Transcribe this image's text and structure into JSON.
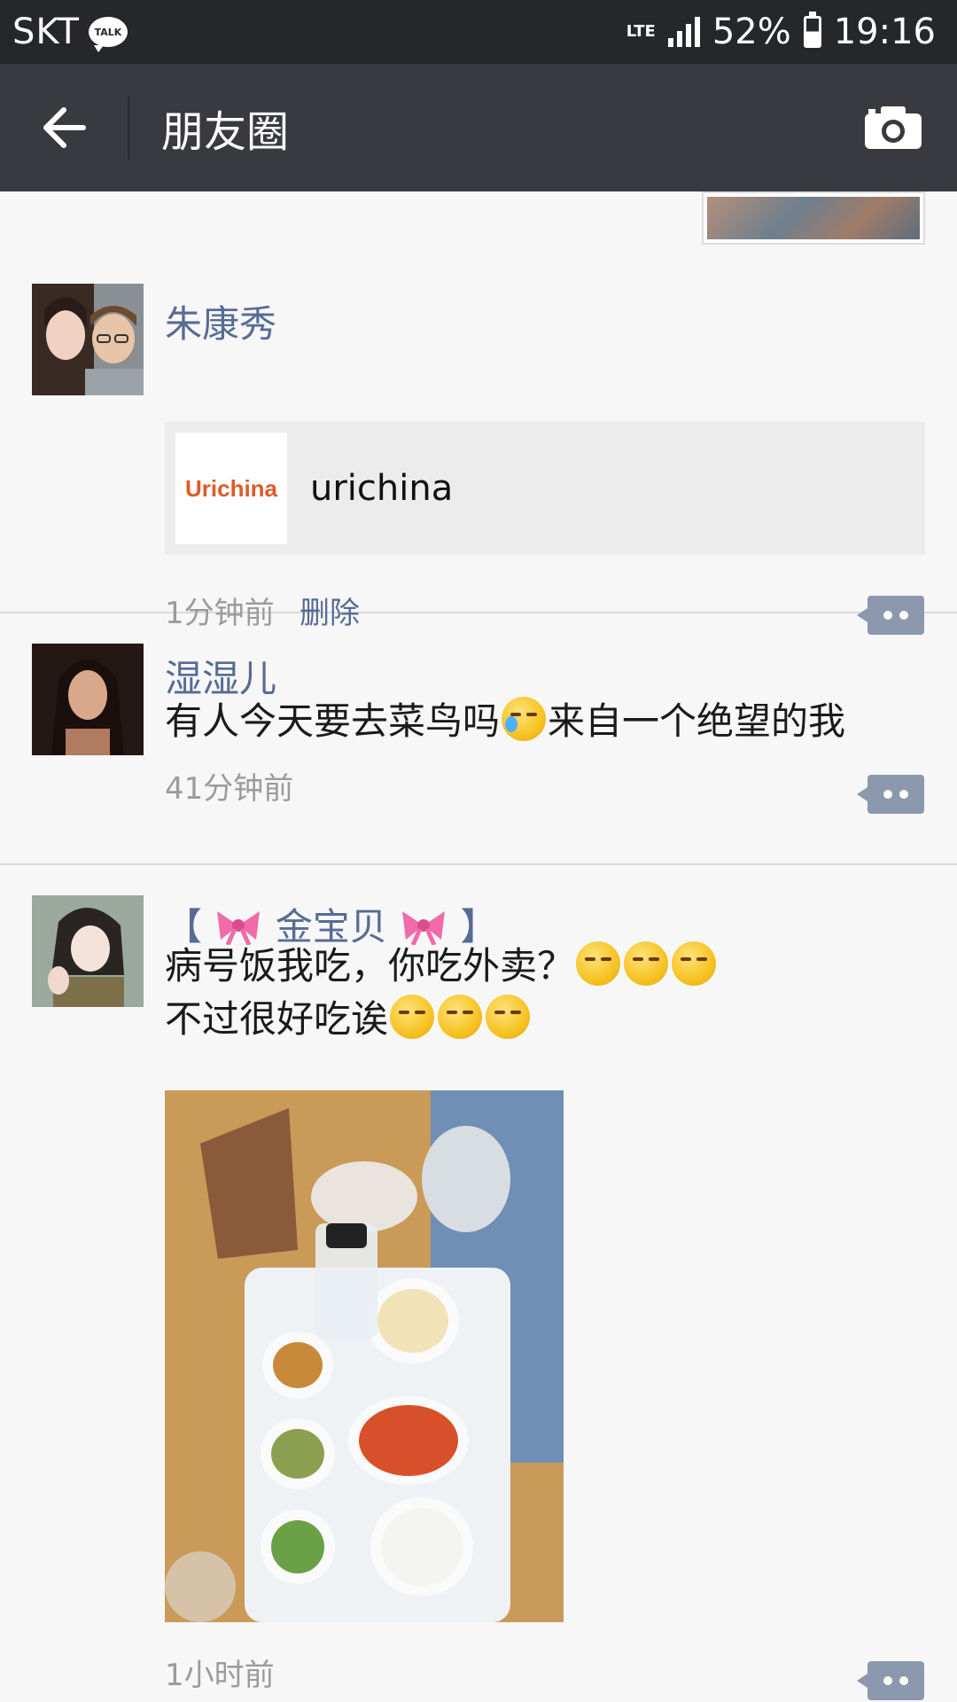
{
  "status_bar": {
    "carrier": "SKT",
    "talk_badge": "TALK",
    "network": "LTE",
    "battery": "52%",
    "battery_level": 0.52,
    "time": "19:16"
  },
  "title_bar": {
    "title": "朋友圈",
    "back_icon": "arrow-left-icon",
    "camera_icon": "camera-icon"
  },
  "posts": [
    {
      "username": "朱康秀",
      "link": {
        "thumb_text": "Urichina",
        "title": "urichina"
      },
      "time": "1分钟前",
      "delete_label": "删除"
    },
    {
      "username": "湿湿儿",
      "text_before": "有人今天要去菜鸟吗",
      "emoji": "crying-laughing-emoji",
      "text_after": "来自一个绝望的我",
      "time": "41分钟前"
    },
    {
      "username_prefix": "【",
      "username_bow": "ribbon-bow-emoji",
      "username": "金宝贝",
      "username_suffix": "】",
      "line1": "病号饭我吃，你吃外卖？",
      "line1_emoji": "smirk-sweat-emoji",
      "line2": "不过很好吃诶",
      "line2_emoji": "thinking-face-emoji",
      "photo": "meal-tray-photo",
      "time": "1小时前"
    }
  ],
  "colors": {
    "status_bar_bg": "#26272b",
    "title_bar_bg": "#393a3f",
    "name_blue": "#576b95",
    "comment_btn": "#8b98ae"
  }
}
